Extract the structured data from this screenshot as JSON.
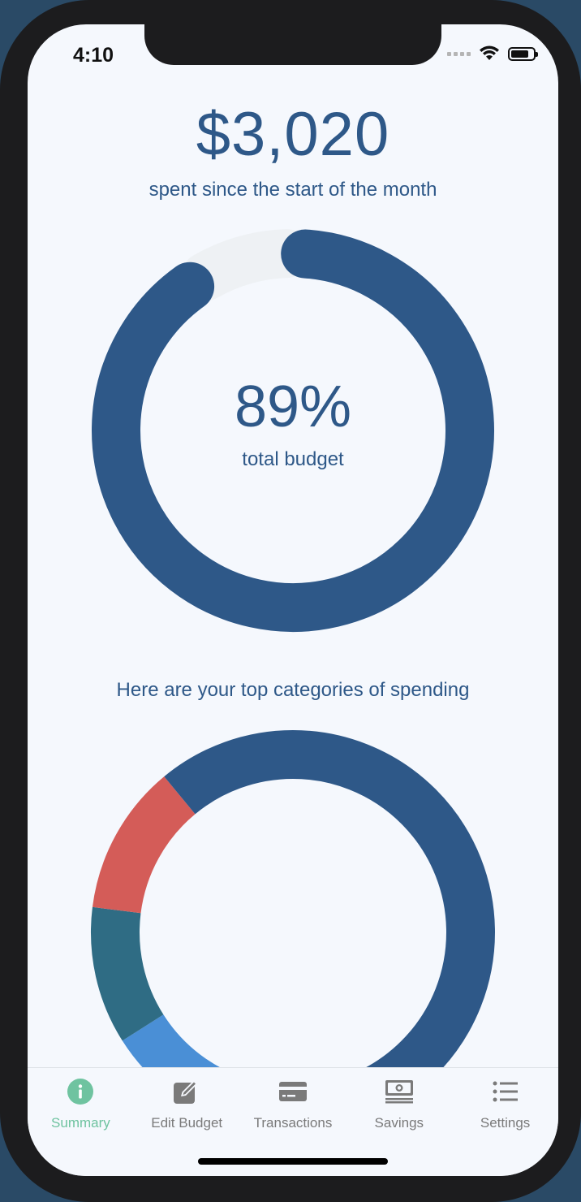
{
  "status_bar": {
    "time": "4:10"
  },
  "summary": {
    "amount": "$3,020",
    "amount_caption": "spent since the start of the month"
  },
  "budget_gauge": {
    "percent_label": "89%",
    "caption": "total budget",
    "fraction": 0.89,
    "colors": {
      "fill": "#2e5888",
      "track": "#eef1f4"
    }
  },
  "categories": {
    "heading": "Here are your top categories of spending"
  },
  "chart_data": {
    "type": "pie",
    "title": "",
    "values": [
      50,
      6,
      10,
      11,
      12,
      11
    ],
    "colors": [
      "#2e5888",
      "#6fc3a0",
      "#4a8fd6",
      "#2f6c84",
      "#d45c58",
      "#2e5888"
    ]
  },
  "tab_bar": {
    "active_color": "#6fc3a0",
    "inactive_color": "#7a7a7a",
    "tabs": [
      {
        "label": "Summary",
        "icon": "info-icon",
        "active": true
      },
      {
        "label": "Edit Budget",
        "icon": "edit-icon",
        "active": false
      },
      {
        "label": "Transactions",
        "icon": "credit-card-icon",
        "active": false
      },
      {
        "label": "Savings",
        "icon": "money-icon",
        "active": false
      },
      {
        "label": "Settings",
        "icon": "list-icon",
        "active": false
      }
    ]
  }
}
